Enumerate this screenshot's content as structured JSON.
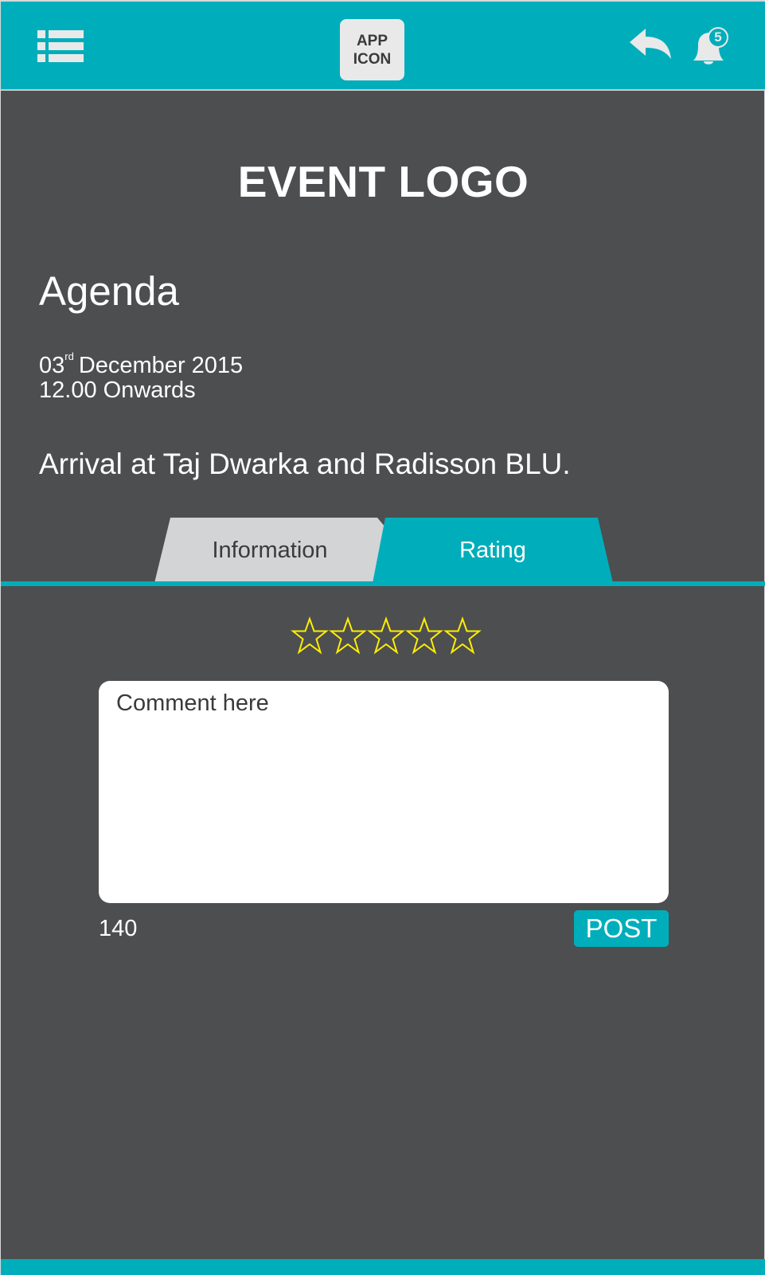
{
  "header": {
    "menu_icon": "list-menu-icon",
    "app_icon_label": "APP\nICON",
    "back_icon": "reply-back-icon",
    "bell_icon": "bell-icon",
    "notification_count": "5"
  },
  "event": {
    "logo_text": "EVENT LOGO",
    "title": "Agenda",
    "date_day": "03",
    "date_suffix": "rd",
    "date_rest": "December 2015",
    "time": "12.00 Onwards",
    "description": "Arrival at Taj Dwarka and Radisson BLU."
  },
  "tabs": [
    {
      "label": "Information",
      "active": false
    },
    {
      "label": "Rating",
      "active": true
    }
  ],
  "rating": {
    "max_stars": 5,
    "selected_stars": 0,
    "star_color": "#ffee00"
  },
  "comment": {
    "placeholder": "Comment here",
    "value": "",
    "chars_remaining": "140",
    "post_label": "POST"
  },
  "colors": {
    "accent": "#00aebb",
    "background": "#4d4e50",
    "inactive_tab": "#d3d4d6"
  }
}
